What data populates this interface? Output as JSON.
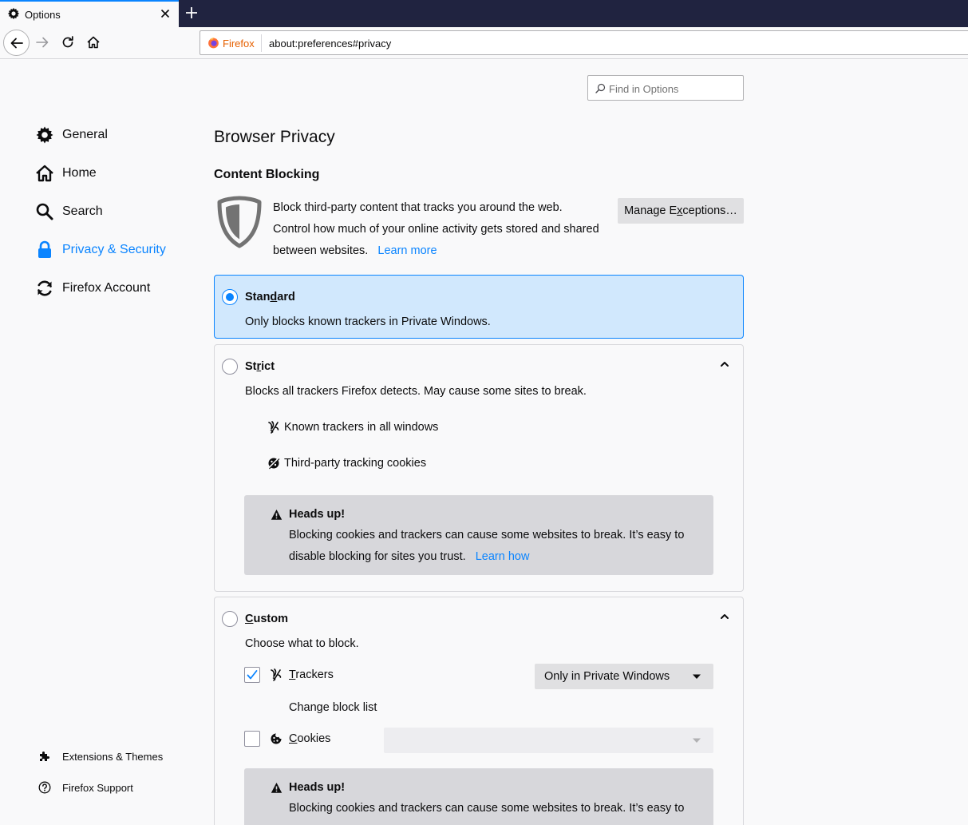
{
  "tab": {
    "title": "Options"
  },
  "urlbar": {
    "identity": "Firefox",
    "url": "about:preferences#privacy"
  },
  "search": {
    "placeholder": "Find in Options"
  },
  "sidebar": {
    "categories": [
      {
        "label": "General",
        "icon": "gear-icon"
      },
      {
        "label": "Home",
        "icon": "home-icon"
      },
      {
        "label": "Search",
        "icon": "search-icon"
      },
      {
        "label": "Privacy & Security",
        "icon": "lock-icon",
        "selected": true
      },
      {
        "label": "Firefox Account",
        "icon": "sync-icon"
      }
    ],
    "footer": [
      {
        "label": "Extensions & Themes",
        "icon": "puzzle-icon"
      },
      {
        "label": "Firefox Support",
        "icon": "help-icon"
      }
    ]
  },
  "main": {
    "page_title": "Browser Privacy",
    "section_title": "Content Blocking",
    "intro_text": "Block third-party content that tracks you around the web. Control how much of your online activity gets stored and shared between websites.",
    "learn_more": "Learn more",
    "manage_exceptions": {
      "pre": "Manage E",
      "accesskey": "x",
      "post": "ceptions…"
    },
    "standard": {
      "title": {
        "pre": "Stan",
        "accesskey": "d",
        "post": "ard"
      },
      "description": "Only blocks known trackers in Private Windows.",
      "checked": true
    },
    "strict": {
      "title": {
        "pre": "St",
        "accesskey": "r",
        "post": "ict"
      },
      "description": "Blocks all trackers Firefox detects. May cause some sites to break.",
      "features": [
        {
          "label": "Known trackers in all windows",
          "icon": "tracker-icon"
        },
        {
          "label": "Third-party tracking cookies",
          "icon": "cookie-blocked-icon"
        }
      ],
      "warning": {
        "title": "Heads up!",
        "text": "Blocking cookies and trackers can cause some websites to break. It’s easy to disable blocking for sites you trust.",
        "link": "Learn how"
      }
    },
    "custom": {
      "title": {
        "pre": "",
        "accesskey": "C",
        "post": "ustom"
      },
      "description": "Choose what to block.",
      "trackers": {
        "label": {
          "pre": "",
          "accesskey": "T",
          "post": "rackers"
        },
        "checked": true,
        "select_value": "Only in Private Windows",
        "change_list": "Change block list"
      },
      "cookies": {
        "label": {
          "pre": "",
          "accesskey": "C",
          "post": "ookies"
        },
        "checked": false
      },
      "warning": {
        "title": "Heads up!",
        "text": "Blocking cookies and trackers can cause some websites to break. It’s easy to"
      }
    }
  },
  "colors": {
    "accent": "#0a84ff",
    "tabstrip": "#202340",
    "selected_card": "#d1e8fd",
    "warning_bg": "#d7d7db"
  }
}
